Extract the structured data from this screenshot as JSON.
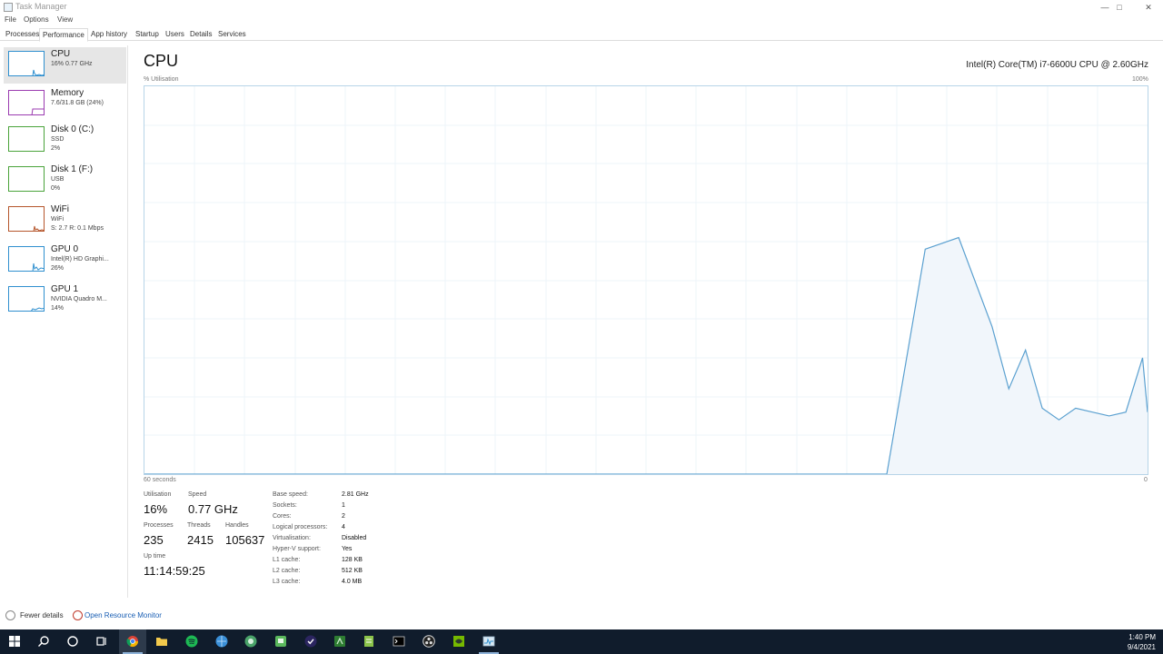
{
  "window": {
    "title": "Task Manager"
  },
  "menu": [
    "File",
    "Options",
    "View"
  ],
  "tabs": [
    "Processes",
    "Performance",
    "App history",
    "Startup",
    "Users",
    "Details",
    "Services"
  ],
  "sidebar": {
    "items": [
      {
        "name": "CPU",
        "sub1": "16% 0.77 GHz",
        "sub2": "",
        "sub3": "",
        "color": "#2f8fcf"
      },
      {
        "name": "Memory",
        "sub1": "7.6/31.8 GB (24%)",
        "sub2": "",
        "sub3": "",
        "color": "#9b3bb0"
      },
      {
        "name": "Disk 0 (C:)",
        "sub1": "SSD",
        "sub2": "2%",
        "sub3": "",
        "color": "#4aa33a"
      },
      {
        "name": "Disk 1 (F:)",
        "sub1": "USB",
        "sub2": "0%",
        "sub3": "",
        "color": "#4aa33a"
      },
      {
        "name": "WiFi",
        "sub1": "WiFi",
        "sub2": "S: 2.7 R: 0.1 Mbps",
        "sub3": "",
        "color": "#b5552b"
      },
      {
        "name": "GPU 0",
        "sub1": "Intel(R) HD Graphi...",
        "sub2": "26%",
        "sub3": "",
        "color": "#2f8fcf"
      },
      {
        "name": "GPU 1",
        "sub1": "NVIDIA Quadro M...",
        "sub2": "14%",
        "sub3": "",
        "color": "#2f8fcf"
      }
    ]
  },
  "main": {
    "title": "CPU",
    "model": "Intel(R) Core(TM) i7-6600U CPU @ 2.60GHz",
    "graph_ylabel": "% Utilisation",
    "graph_ymax": "100%",
    "graph_xlabel": "60 seconds",
    "graph_xmin": "0",
    "line_color": "#5aa0d0",
    "fill_color": "#f1f6fb"
  },
  "chart_data": {
    "type": "area",
    "ylim": [
      0,
      100
    ],
    "xlim": [
      60,
      0
    ],
    "x": [
      60,
      13.3,
      11.3,
      9.3,
      8.3,
      7.3,
      6.3,
      5.3,
      4.3,
      3.3,
      2.3,
      1.3,
      0.3,
      0
    ],
    "values": [
      0,
      58,
      61,
      38,
      22,
      32,
      17,
      14,
      17,
      16,
      15,
      16,
      30,
      16
    ],
    "gridlines": true
  },
  "stats": {
    "utilisation_label": "Utilisation",
    "utilisation": "16%",
    "speed_label": "Speed",
    "speed": "0.77 GHz",
    "processes_label": "Processes",
    "processes": "235",
    "threads_label": "Threads",
    "threads": "2415",
    "handles_label": "Handles",
    "handles": "105637",
    "uptime_label": "Up time",
    "uptime": "11:14:59:25"
  },
  "details": [
    {
      "key": "Base speed:",
      "value": "2.81 GHz"
    },
    {
      "key": "Sockets:",
      "value": "1"
    },
    {
      "key": "Cores:",
      "value": "2"
    },
    {
      "key": "Logical processors:",
      "value": "4"
    },
    {
      "key": "Virtualisation:",
      "value": "Disabled"
    },
    {
      "key": "Hyper-V support:",
      "value": "Yes"
    },
    {
      "key": "L1 cache:",
      "value": "128 KB"
    },
    {
      "key": "L2 cache:",
      "value": "512 KB"
    },
    {
      "key": "L3 cache:",
      "value": "4.0 MB"
    }
  ],
  "footer": {
    "fewer_details": "Fewer details",
    "open_resource_monitor": "Open Resource Monitor"
  },
  "taskbar": {
    "time": "1:40 PM",
    "date": "9/4/2021",
    "icons": [
      "start-icon",
      "search-icon",
      "cortana-icon",
      "task-view-icon",
      "chrome-icon",
      "file-explorer-icon",
      "spotify-icon",
      "browser-icon",
      "network-icon",
      "app-green-icon",
      "app-purple-icon",
      "app-green2-icon",
      "notepad-icon",
      "terminal-icon",
      "obs-icon",
      "nvidia-icon",
      "task-manager-icon"
    ]
  }
}
